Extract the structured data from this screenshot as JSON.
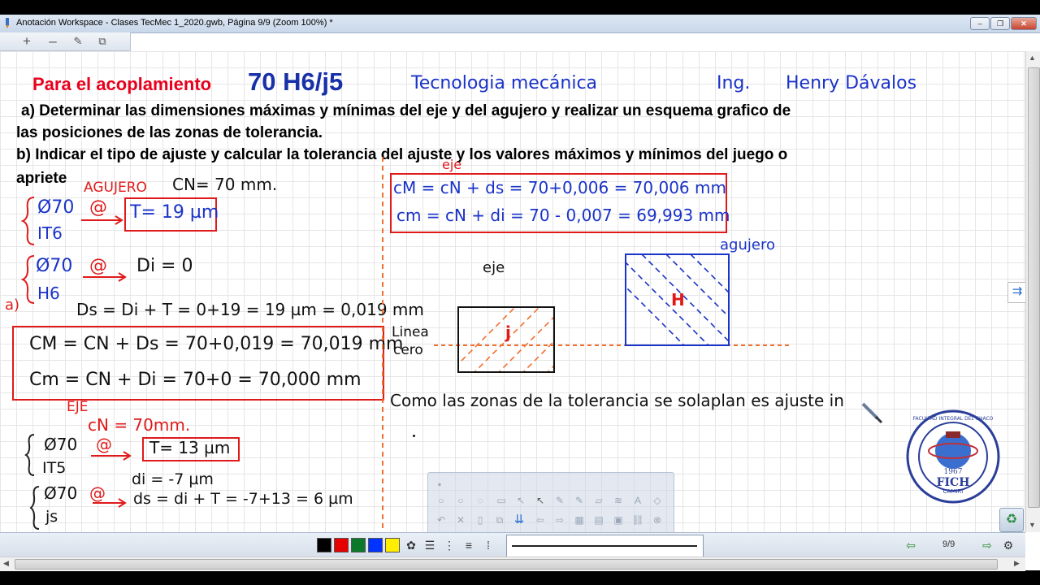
{
  "window": {
    "title": "Anotación Workspace - Clases TecMec 1_2020.gwb, Página 9/9  (Zoom 100%) *",
    "minimize": "–",
    "restore": "❐",
    "close": "✕"
  },
  "toolbar": {
    "add": "+",
    "remove": "–",
    "edit": "✎",
    "pages": "⧉"
  },
  "slide": {
    "title_text": "Para el acoplamiento",
    "title_code": "70 H6/j5",
    "subject": "Tecnologia mecánica",
    "ing": "Ing.",
    "author": "Henry Dávalos",
    "q_a_line1": "a)  Determinar  las  dimensiones máximas  y mínimas del  eje  y del  agujero  y realizar  un esquema grafico de",
    "q_a_line2": "las posiciones de las zonas de tolerancia.",
    "q_b_line1": "b)  Indicar  el tipo de ajuste  y calcular  la  tolerancia  del  ajuste  y los  valores  máximos  y mínimos del juego o",
    "q_b_line2": "apriete"
  },
  "handwriting": {
    "agujero_heading": "AGUJERO",
    "cn_hole": "CN= 70 mm.",
    "phi70_1": "Ø70",
    "it6": "IT6",
    "at1": "@",
    "t19": "T= 19 µm",
    "phi70_2": "Ø70",
    "h6": "H6",
    "at2": "@",
    "di0": "Di = 0",
    "a_mark": "a)",
    "ds_calc": "Ds = Di + T = 0+19 = 19 µm = 0,019 mm",
    "cm_max": "CM = CN + Ds = 70+0,019 = 70,019 mm",
    "cm_min": "Cm = CN + Di = 70+0   = 70,000 mm",
    "eje_heading": "EJE",
    "cn_shaft": "cN = 70mm.",
    "phi70_3": "Ø70",
    "it5": "IT5",
    "at3": "@",
    "t13": "T= 13 µm",
    "phi70_4": "Ø70",
    "js5": "js",
    "at4": "@",
    "di_neg7": "di = -7 µm",
    "ds_calc2": "ds = di + T = -7+13 = 6 µm",
    "eje_label_right": "eje",
    "cM_shaft": "cM = cN + ds = 70+0,006 = 70,006 mm",
    "cm_shaft": "cm = cN + di = 70 - 0,007 = 69,993 mm",
    "eje_label": "eje",
    "agujero_label": "agujero",
    "linea_cero_1": "Linea",
    "linea_cero_2": "cero",
    "j_label": "j",
    "h_label": "H",
    "conclusion": "Como las zonas de la tolerancia se solaplan es ajuste in"
  },
  "logo": {
    "year": "1967",
    "name": "FICH",
    "city": "CAMIRI",
    "ring_text": "FACULTAD INTEGRAL DEL CHACO"
  },
  "bottombar": {
    "page_indicator": "9/9"
  },
  "colors": {
    "red_ink": "#e01a1a",
    "blue_ink": "#1a33c8",
    "orange_ink": "#f07030",
    "palette": [
      "#000000",
      "#e60000",
      "#0a7a2a",
      "#0033ff",
      "#ffee00"
    ]
  }
}
